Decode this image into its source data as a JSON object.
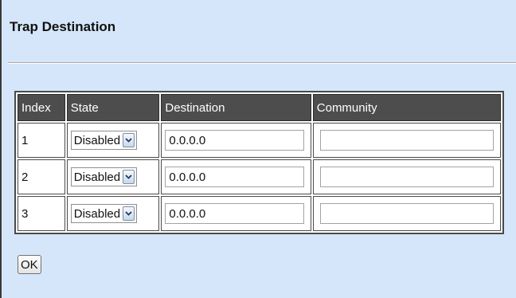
{
  "page": {
    "title": "Trap Destination"
  },
  "table": {
    "headers": {
      "index": "Index",
      "state": "State",
      "destination": "Destination",
      "community": "Community"
    },
    "rows": [
      {
        "index": "1",
        "state": "Disabled",
        "destination": "0.0.0.0",
        "community": ""
      },
      {
        "index": "2",
        "state": "Disabled",
        "destination": "0.0.0.0",
        "community": ""
      },
      {
        "index": "3",
        "state": "Disabled",
        "destination": "0.0.0.0",
        "community": ""
      }
    ]
  },
  "actions": {
    "ok_label": "OK"
  },
  "colors": {
    "page_background": "#d6e6fa",
    "header_background": "#4d4d4d",
    "header_text": "#ffffff"
  },
  "icons": {
    "dropdown": "chevron-down-icon"
  }
}
